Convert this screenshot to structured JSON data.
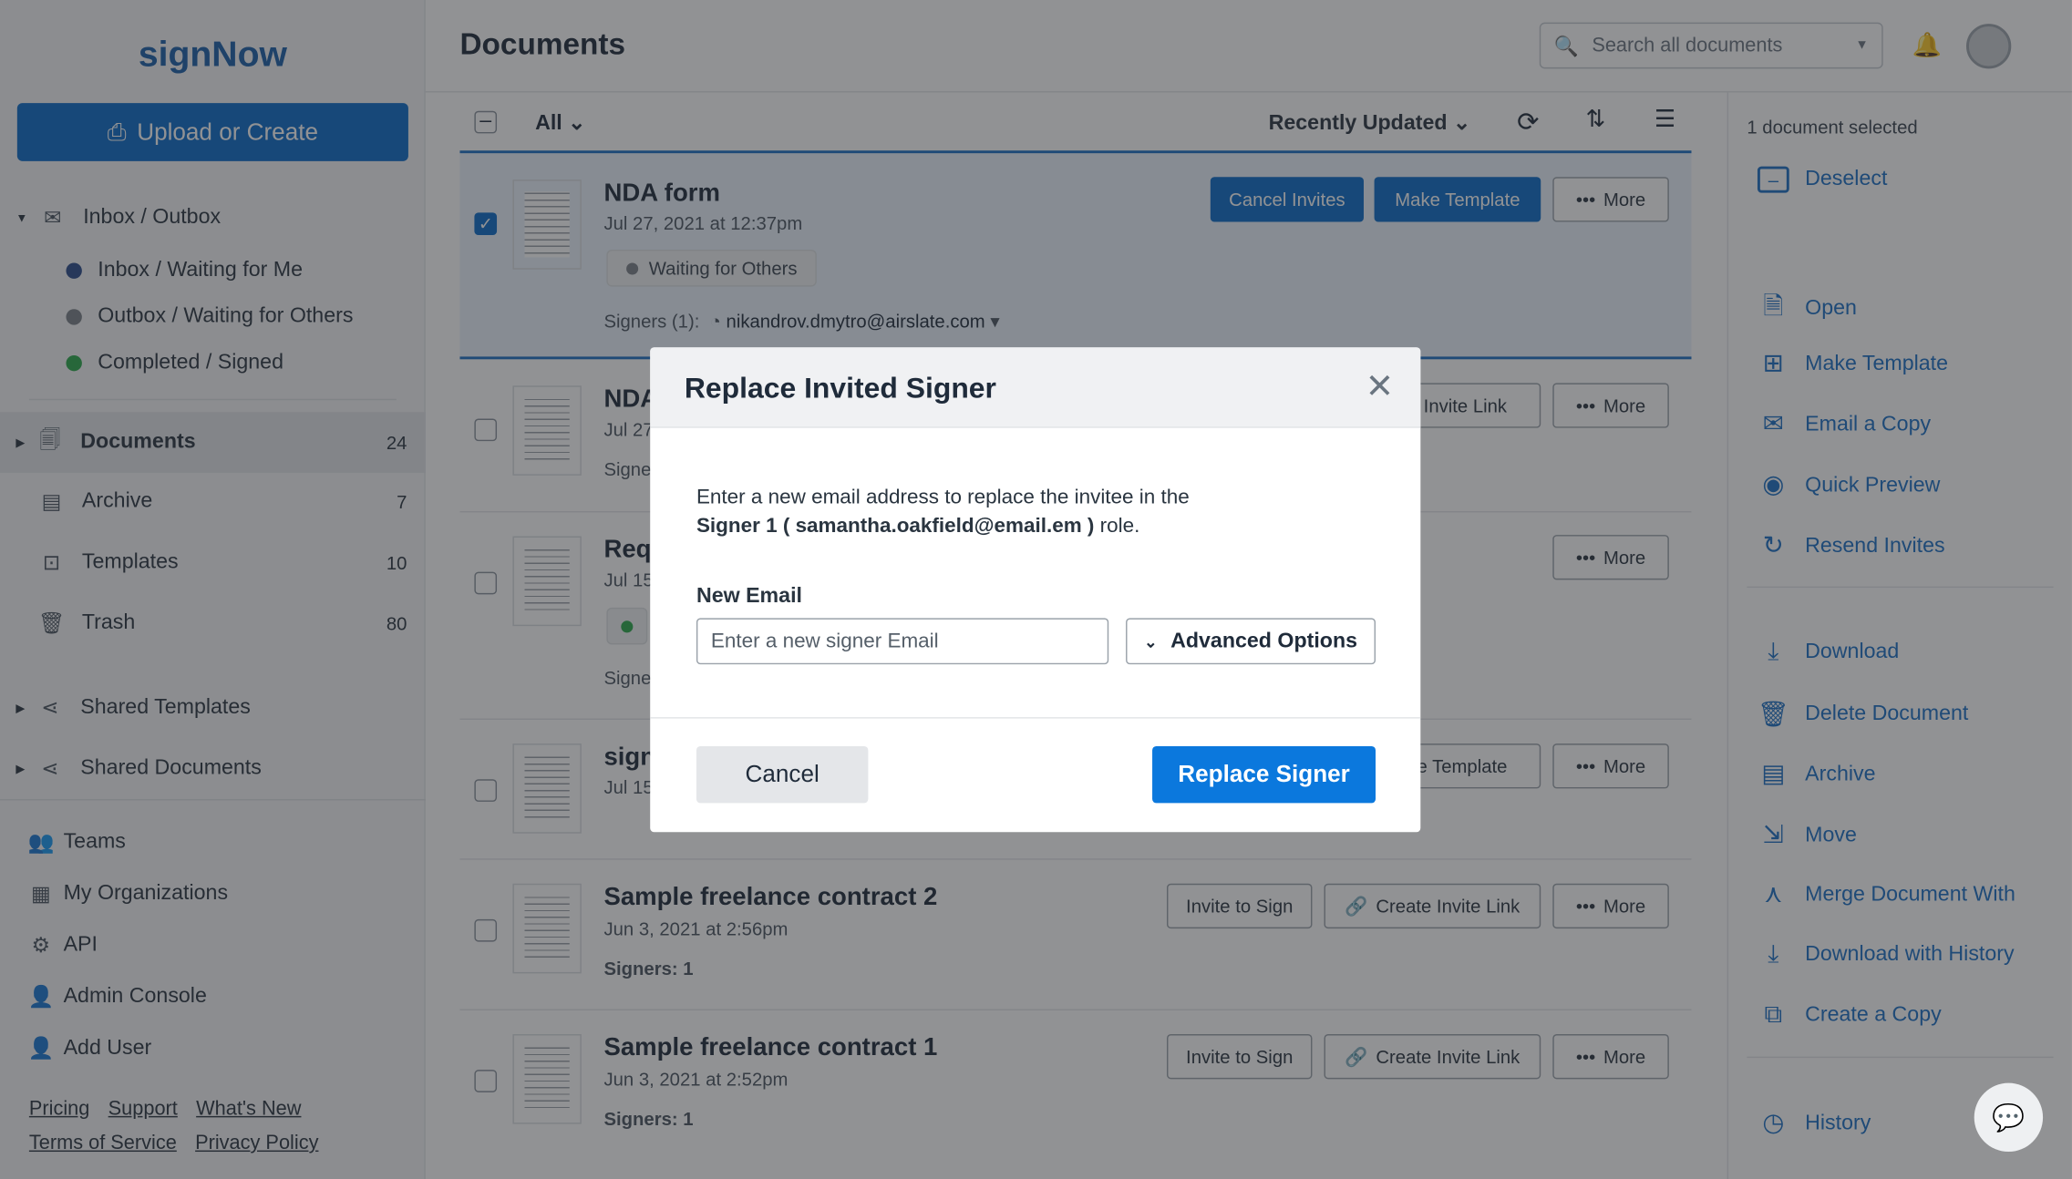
{
  "app": {
    "logo": "signNow",
    "upload": "Upload or Create"
  },
  "sidebar": {
    "inbox": "Inbox / Outbox",
    "sub": [
      {
        "label": "Inbox / Waiting for Me",
        "color": "#2a4a8a"
      },
      {
        "label": "Outbox / Waiting for Others",
        "color": "#7a8088"
      },
      {
        "label": "Completed / Signed",
        "color": "#2aa84a"
      }
    ],
    "folders": [
      {
        "label": "Documents",
        "count": "24"
      },
      {
        "label": "Archive",
        "count": "7"
      },
      {
        "label": "Templates",
        "count": "10"
      },
      {
        "label": "Trash",
        "count": "80"
      }
    ],
    "shared": [
      "Shared Templates",
      "Shared Documents"
    ],
    "links": [
      "Teams",
      "My Organizations",
      "API",
      "Admin Console",
      "Add User"
    ],
    "footer": [
      "Pricing",
      "Support",
      "What's New",
      "Terms of Service",
      "Privacy Policy"
    ]
  },
  "header": {
    "title": "Documents",
    "search_placeholder": "Search all documents"
  },
  "toolbar": {
    "filter": "All",
    "sort": "Recently Updated"
  },
  "documents": [
    {
      "name": "NDA form",
      "date": "Jul 27, 2021 at 12:37pm",
      "status": "Waiting for Others",
      "signers_label": "Signers (1):",
      "signer": "nikandrov.dmytro@airslate.com",
      "buttons": [
        "Cancel Invites",
        "Make Template",
        "More"
      ],
      "selected": true
    },
    {
      "name": "NDA",
      "date": "Jul 27,",
      "signers": "Signe",
      "buttons": [
        "e Invite Link",
        "More"
      ]
    },
    {
      "name": "Req",
      "date": "Jul 15,",
      "signers": "Signe",
      "buttons": [
        "More"
      ]
    },
    {
      "name": "sign",
      "date": "Jul 15,",
      "buttons": [
        "ke Template",
        "More"
      ]
    },
    {
      "name": "Sample freelance contract 2",
      "date": "Jun 3, 2021 at 2:56pm",
      "signers": "Signers: 1",
      "buttons": [
        "Invite to Sign",
        "Create Invite Link",
        "More"
      ]
    },
    {
      "name": "Sample freelance contract 1",
      "date": "Jun 3, 2021 at 2:52pm",
      "signers": "Signers: 1",
      "buttons": [
        "Invite to Sign",
        "Create Invite Link",
        "More"
      ]
    }
  ],
  "panel": {
    "selected": "1 document selected",
    "deselect": "Deselect",
    "actions": [
      {
        "label": "Open",
        "icon": "document-icon"
      },
      {
        "label": "Make Template",
        "icon": "template-icon"
      },
      {
        "label": "Email a Copy",
        "icon": "envelope-icon"
      },
      {
        "label": "Quick Preview",
        "icon": "eye-icon"
      },
      {
        "label": "Resend Invites",
        "icon": "refresh-icon"
      },
      {
        "label": "Download",
        "icon": "download-icon"
      },
      {
        "label": "Delete Document",
        "icon": "trash-icon"
      },
      {
        "label": "Archive",
        "icon": "archive-icon"
      },
      {
        "label": "Move",
        "icon": "move-icon"
      },
      {
        "label": "Merge Document With",
        "icon": "merge-icon"
      },
      {
        "label": "Download with History",
        "icon": "download-history-icon"
      },
      {
        "label": "Create a Copy",
        "icon": "copy-icon"
      },
      {
        "label": "History",
        "icon": "clock-icon"
      }
    ]
  },
  "modal": {
    "title": "Replace Invited Signer",
    "text": "Enter a new email address to replace the invitee in the",
    "role_prefix": "Signer 1 ( samantha.oakfield@email.em )",
    "role_suffix": " role.",
    "field_label": "New Email",
    "placeholder": "Enter a new signer Email",
    "advanced": "Advanced Options",
    "cancel": "Cancel",
    "replace": "Replace Signer"
  }
}
